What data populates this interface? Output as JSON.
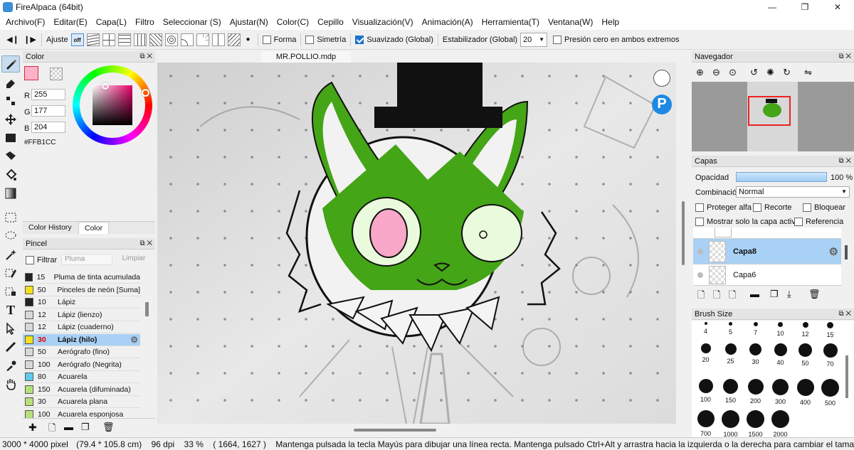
{
  "window": {
    "title": "FireAlpaca (64bit)"
  },
  "menu": [
    "Archivo(F)",
    "Editar(E)",
    "Capa(L)",
    "Filtro",
    "Seleccionar (S)",
    "Ajustar(N)",
    "Color(C)",
    "Cepillo",
    "Visualización(V)",
    "Animación(A)",
    "Herramienta(T)",
    "Ventana(W)",
    "Help"
  ],
  "toolbar": {
    "ajuste_label": "Ajuste",
    "off_label": "off",
    "forma_label": "Forma",
    "simetria_label": "Simetría",
    "suavizado_label": "Suavizado (Global)",
    "estabilizador_label": "Estabilizador (Global)",
    "estabilizador_value": "20",
    "presion_label": "Presión cero en ambos extremos"
  },
  "color_panel": {
    "title": "Color",
    "r_label": "R",
    "r_value": "255",
    "g_label": "G",
    "g_value": "177",
    "b_label": "B",
    "b_value": "204",
    "hex": "#FFB1CC",
    "tab_history": "Color History",
    "tab_color": "Color",
    "current_color": "#FFB1CC"
  },
  "brush_panel": {
    "title": "Pincel",
    "filter_label": "Filtrar",
    "search_placeholder": "Pluma",
    "clear_label": "Limpiar",
    "brushes": [
      {
        "size": "15",
        "name": "Pluma de tinta acumulada",
        "color": "#222222"
      },
      {
        "size": "50",
        "name": "Pinceles de neón [Suma]",
        "color": "#f2e01c"
      },
      {
        "size": "10",
        "name": "Lápiz",
        "color": "#222222"
      },
      {
        "size": "12",
        "name": "Lápiz (lienzo)",
        "color": "#d8d8d8"
      },
      {
        "size": "12",
        "name": "Lápiz (cuaderno)",
        "color": "#d8d8d8"
      },
      {
        "size": "30",
        "name": "Lápiz (hilo)",
        "color": "#f2e01c"
      },
      {
        "size": "50",
        "name": "Aerógrafo (fino)",
        "color": "#d8d8d8"
      },
      {
        "size": "100",
        "name": "Aerógrafo (Negrita)",
        "color": "#d8d8d8"
      },
      {
        "size": "80",
        "name": "Acuarela",
        "color": "#5ecbf0"
      },
      {
        "size": "150",
        "name": "Acuarela (difuminada)",
        "color": "#b6e07a"
      },
      {
        "size": "30",
        "name": "Acuarela plana",
        "color": "#b6e07a"
      },
      {
        "size": "100",
        "name": "Acuarela esponjosa",
        "color": "#b6e07a"
      }
    ]
  },
  "document": {
    "tab": "MR.POLLIO.mdp"
  },
  "navigator": {
    "title": "Navegador"
  },
  "layers": {
    "title": "Capas",
    "opacity_label": "Opacidad",
    "opacity_value": "100 %",
    "opacity_fraction": 1.0,
    "blend_label": "Combinación",
    "blend_value": "Normal",
    "protect_alpha": "Proteger alfa",
    "clip": "Recorte",
    "lock": "Bloquear",
    "show_active": "Mostrar solo la capa activa",
    "reference": "Referencia",
    "items": [
      {
        "name": "Capa8"
      },
      {
        "name": "Capa6"
      }
    ]
  },
  "brush_size": {
    "title": "Brush Size",
    "sizes": [
      "4",
      "5",
      "7",
      "10",
      "12",
      "15",
      "20",
      "25",
      "30",
      "40",
      "50",
      "70",
      "100",
      "150",
      "200",
      "300",
      "400",
      "500",
      "700",
      "1000",
      "1500",
      "2000"
    ]
  },
  "status": {
    "dimensions": "3000 * 4000 pixel",
    "physical": "(79.4 * 105.8 cm)",
    "dpi": "96 dpi",
    "zoom": "33 %",
    "coords": "( 1664, 1627 )",
    "hint": "Mantenga pulsada la tecla Mayús para dibujar una línea recta. Mantenga pulsado Ctrl+Alt y arrastra hacia la izquierda o la derecha para cambiar el tamaño del p"
  }
}
